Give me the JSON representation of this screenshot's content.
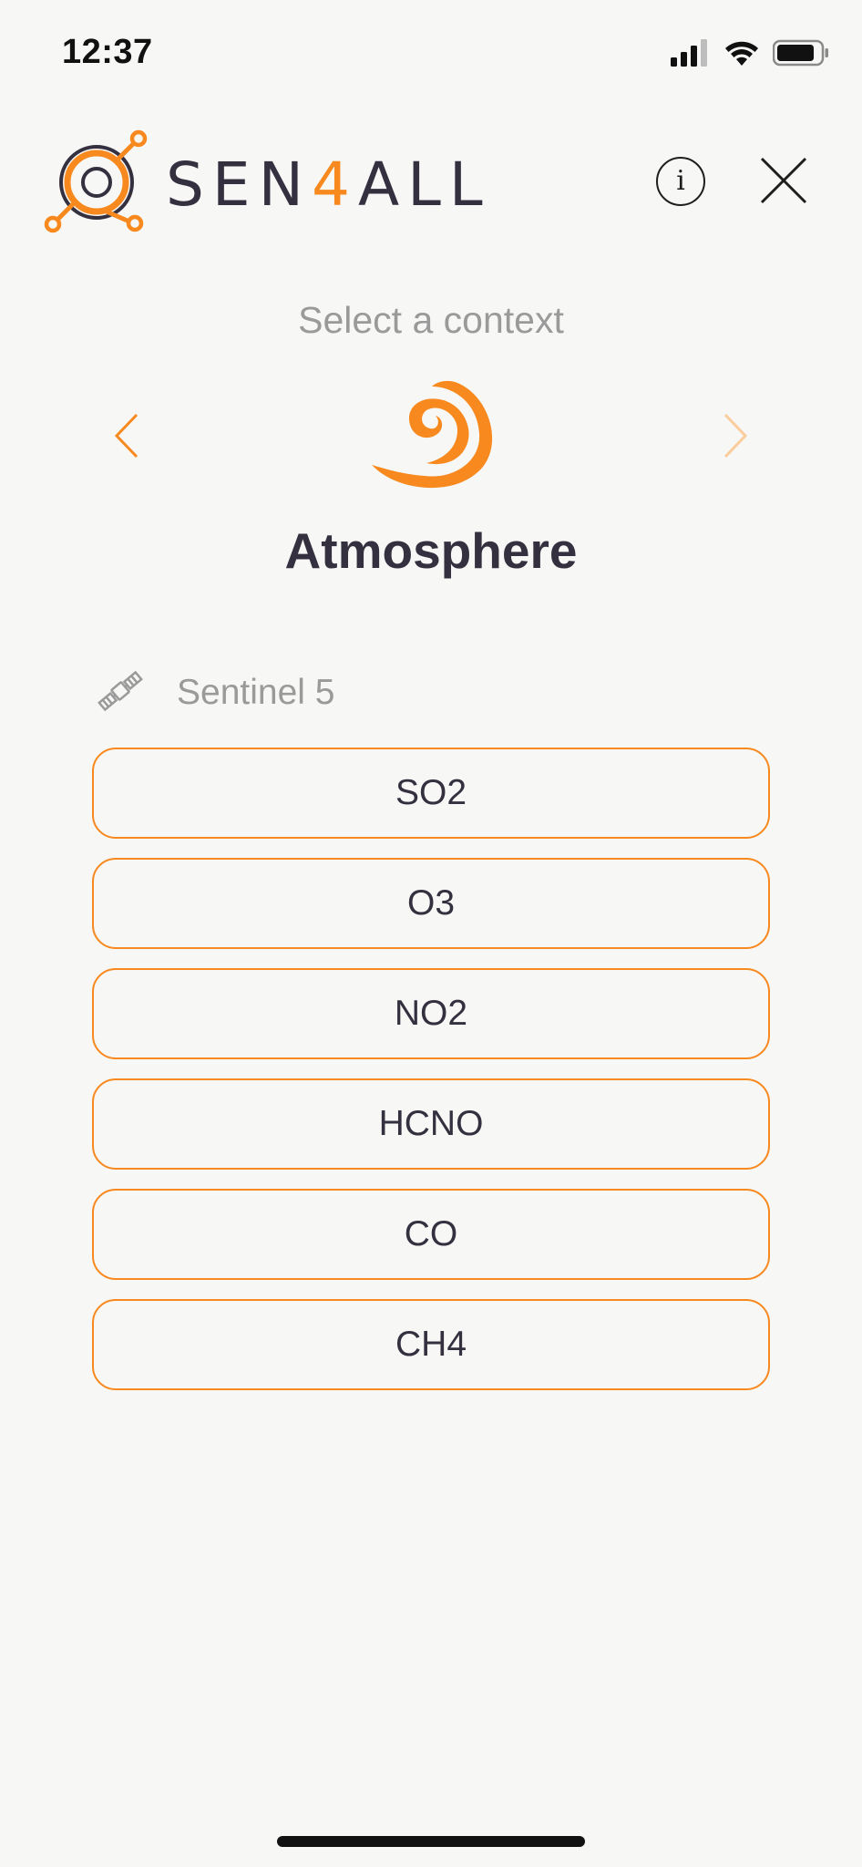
{
  "status_bar": {
    "time": "12:37",
    "signal_icon": "cellular-signal-icon",
    "wifi_icon": "wifi-icon",
    "battery_icon": "battery-icon"
  },
  "header": {
    "logo_text_before": "SEN",
    "logo_text_accent": "4",
    "logo_text_after": "ALL",
    "logo_icon": "sen4all-logo-icon",
    "info_icon": "info-icon",
    "info_glyph": "i",
    "close_icon": "close-icon"
  },
  "context": {
    "prompt": "Select a context",
    "name": "Atmosphere",
    "icon": "atmosphere-swirl-icon",
    "prev_icon": "chevron-left-icon",
    "next_icon": "chevron-right-icon"
  },
  "sensor": {
    "icon": "satellite-icon",
    "label": "Sentinel 5"
  },
  "options": [
    {
      "label": "SO2"
    },
    {
      "label": "O3"
    },
    {
      "label": "NO2"
    },
    {
      "label": "HCNO"
    },
    {
      "label": "CO"
    },
    {
      "label": "CH4"
    }
  ],
  "colors": {
    "accent": "#f7891f",
    "text_dark": "#35303f",
    "text_muted": "#9a9a9a",
    "background": "#f7f7f5"
  }
}
